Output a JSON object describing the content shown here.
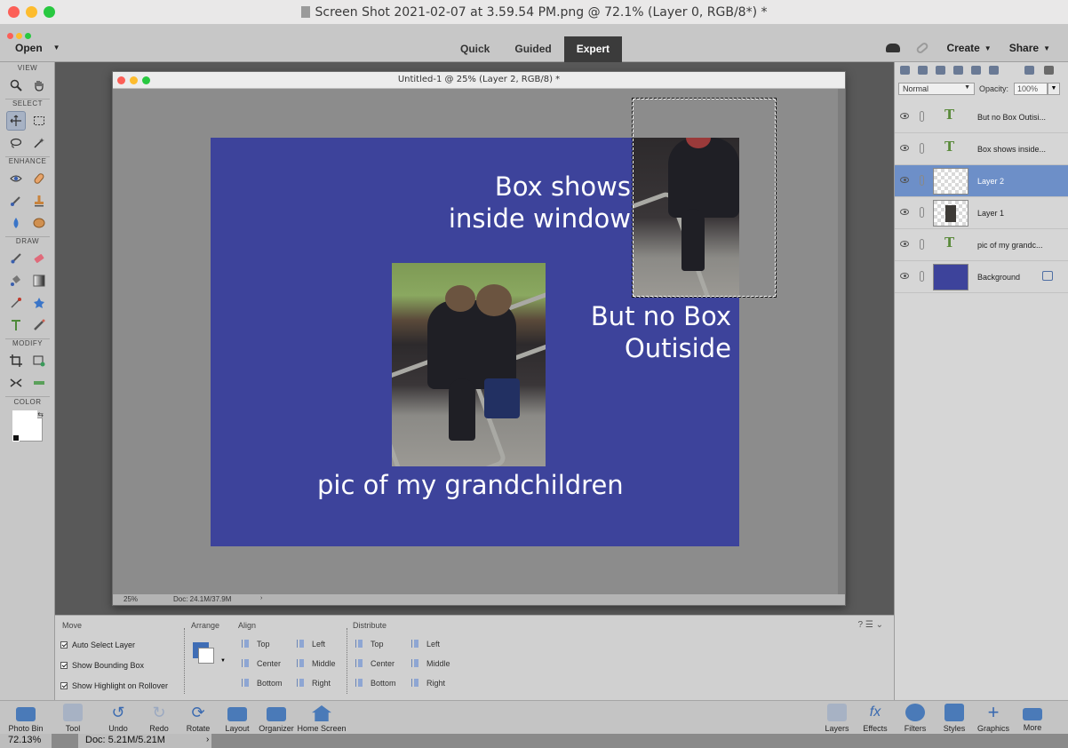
{
  "window": {
    "title": "Screen Shot 2021-02-07 at 3.59.54 PM.png @ 72.1% (Layer 0, RGB/8*) *"
  },
  "menubar": {
    "open_label": "Open",
    "modes": [
      "Quick",
      "Guided",
      "Expert"
    ],
    "active_mode": "Expert",
    "create_label": "Create",
    "share_label": "Share"
  },
  "toolbox": {
    "sections": [
      "VIEW",
      "SELECT",
      "ENHANCE",
      "DRAW",
      "MODIFY",
      "COLOR"
    ],
    "tools": [
      "zoom-tool",
      "hand-tool",
      "move-tool",
      "marquee-tool",
      "lasso-tool",
      "magic-wand-tool",
      "red-eye-tool",
      "spot-healing-tool",
      "smart-brush-tool",
      "clone-stamp-tool",
      "blur-tool",
      "sponge-tool",
      "brush-tool",
      "eraser-tool",
      "paint-bucket-tool",
      "gradient-tool",
      "eyedropper-tool",
      "custom-shape-tool",
      "type-tool",
      "pencil-tool",
      "crop-tool",
      "recompose-tool",
      "content-aware-move-tool",
      "straighten-tool"
    ]
  },
  "document": {
    "title": "Untitled-1 @ 25% (Layer 2, RGB/8) *",
    "zoom": "25%",
    "doc_size": "Doc: 24.1M/37.9M",
    "canvas_texts": {
      "box_shows": "Box shows\ninside window",
      "but_no_box": "But no Box\nOutiside",
      "pic_caption": "pic of my grandchildren"
    },
    "colors": {
      "canvas_bg": "#3d439b"
    }
  },
  "layers_panel": {
    "blend_mode": "Normal",
    "opacity_label": "Opacity:",
    "opacity_value": "100%",
    "layers": [
      {
        "name": "But no Box Outisi...",
        "kind": "text"
      },
      {
        "name": "Box shows inside...",
        "kind": "text"
      },
      {
        "name": "Layer 2",
        "kind": "pixel",
        "selected": true
      },
      {
        "name": "Layer 1",
        "kind": "pixel"
      },
      {
        "name": "pic of my grandc...",
        "kind": "text"
      },
      {
        "name": "Background",
        "kind": "background"
      }
    ]
  },
  "tool_options": {
    "move_label": "Move",
    "checkboxes": [
      "Auto Select Layer",
      "Show Bounding Box",
      "Show Highlight on Rollover"
    ],
    "arrange_label": "Arrange",
    "align_label": "Align",
    "align_items": [
      "Top",
      "Center",
      "Bottom",
      "Left",
      "Middle",
      "Right"
    ],
    "distribute_label": "Distribute",
    "distribute_items": [
      "Top",
      "Center",
      "Bottom",
      "Left",
      "Middle",
      "Right"
    ]
  },
  "taskbar": {
    "left_items": [
      "Photo Bin",
      "Tool Options",
      "Undo",
      "Redo",
      "Rotate",
      "Layout",
      "Organizer",
      "Home Screen"
    ],
    "right_items": [
      "Layers",
      "Effects",
      "Filters",
      "Styles",
      "Graphics",
      "More"
    ]
  },
  "statusbar": {
    "zoom": "72.13%",
    "doc_size": "Doc: 5.21M/5.21M"
  }
}
